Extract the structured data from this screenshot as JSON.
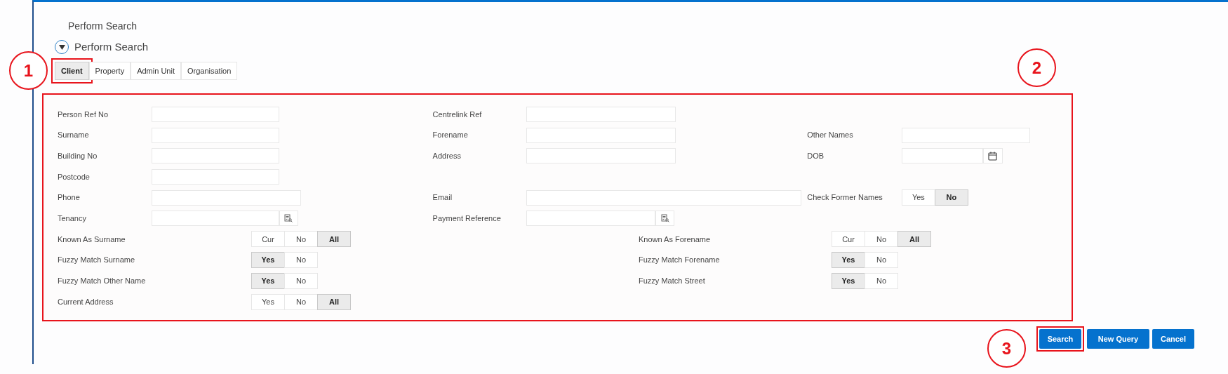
{
  "page_title": "Perform Search",
  "section": {
    "title": "Perform Search",
    "expanded": true
  },
  "tabs": [
    {
      "label": "Client",
      "selected": true,
      "highlighted": true
    },
    {
      "label": "Property",
      "selected": false,
      "highlighted": false
    },
    {
      "label": "Admin Unit",
      "selected": false,
      "highlighted": false
    },
    {
      "label": "Organisation",
      "selected": false,
      "highlighted": false
    }
  ],
  "form": {
    "highlighted": true,
    "rows": [
      {
        "kind": "inputs",
        "left": {
          "label": "Person Ref No",
          "kind": "text"
        },
        "middle": {
          "label": "Centrelink Ref",
          "kind": "text"
        }
      },
      {
        "kind": "inputs",
        "left": {
          "label": "Surname",
          "kind": "text"
        },
        "middle": {
          "label": "Forename",
          "kind": "text"
        },
        "right": {
          "label": "Other Names",
          "kind": "text"
        }
      },
      {
        "kind": "inputs",
        "left": {
          "label": "Building No",
          "kind": "text"
        },
        "middle": {
          "label": "Address",
          "kind": "text"
        },
        "right": {
          "label": "DOB",
          "kind": "date"
        }
      },
      {
        "kind": "inputs",
        "left": {
          "label": "Postcode",
          "kind": "text"
        }
      },
      {
        "kind": "inputs",
        "left": {
          "label": "Phone",
          "kind": "long-text"
        },
        "middle": {
          "label": "Email",
          "kind": "long-text"
        },
        "right": {
          "label": "Check Former Names",
          "kind": "toggle",
          "options": [
            {
              "label": "Yes",
              "selected": false
            },
            {
              "label": "No",
              "selected": true
            }
          ]
        }
      },
      {
        "kind": "inputs",
        "left": {
          "label": "Tenancy",
          "kind": "lookup"
        },
        "middle": {
          "label": "Payment Reference",
          "kind": "lookup"
        }
      },
      {
        "kind": "toggles",
        "left": {
          "label": "Known As Surname",
          "kind": "toggle",
          "options": [
            {
              "label": "Cur",
              "selected": false
            },
            {
              "label": "No",
              "selected": false
            },
            {
              "label": "All",
              "selected": true
            }
          ]
        },
        "right": {
          "label": "Known As Forename",
          "kind": "toggle",
          "options": [
            {
              "label": "Cur",
              "selected": false
            },
            {
              "label": "No",
              "selected": false
            },
            {
              "label": "All",
              "selected": true
            }
          ]
        }
      },
      {
        "kind": "toggles",
        "left": {
          "label": "Fuzzy Match Surname",
          "kind": "toggle",
          "options": [
            {
              "label": "Yes",
              "selected": true
            },
            {
              "label": "No",
              "selected": false
            }
          ]
        },
        "right": {
          "label": "Fuzzy Match Forename",
          "kind": "toggle",
          "options": [
            {
              "label": "Yes",
              "selected": true
            },
            {
              "label": "No",
              "selected": false
            }
          ]
        }
      },
      {
        "kind": "toggles",
        "left": {
          "label": "Fuzzy Match Other Name",
          "kind": "toggle",
          "options": [
            {
              "label": "Yes",
              "selected": true
            },
            {
              "label": "No",
              "selected": false
            }
          ]
        },
        "right": {
          "label": "Fuzzy Match Street",
          "kind": "toggle",
          "options": [
            {
              "label": "Yes",
              "selected": true
            },
            {
              "label": "No",
              "selected": false
            }
          ]
        }
      },
      {
        "kind": "toggles",
        "left": {
          "label": "Current Address",
          "kind": "toggle",
          "options": [
            {
              "label": "Yes",
              "selected": false
            },
            {
              "label": "No",
              "selected": false
            },
            {
              "label": "All",
              "selected": true
            }
          ]
        }
      }
    ]
  },
  "buttons": [
    {
      "label": "Search",
      "highlighted": true
    },
    {
      "label": "New Query",
      "highlighted": false
    },
    {
      "label": "Cancel",
      "highlighted": false
    }
  ],
  "annotations": [
    {
      "label": "1"
    },
    {
      "label": "2"
    },
    {
      "label": "3"
    }
  ]
}
